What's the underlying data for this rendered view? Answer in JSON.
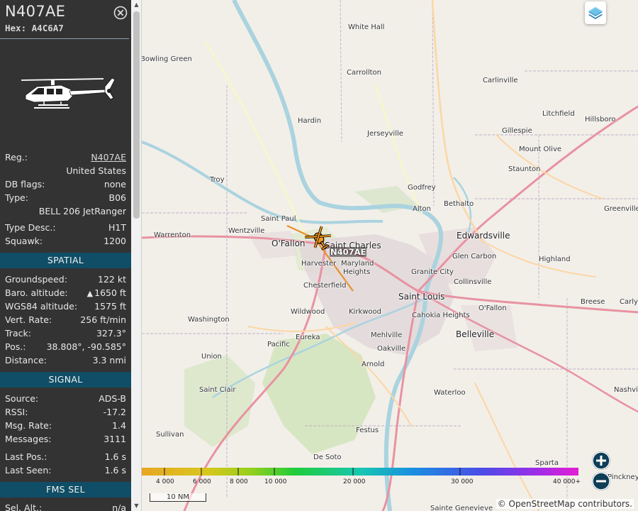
{
  "aircraft": {
    "callsign": "N407AE",
    "hex_label": "Hex:",
    "hex": "A4C6A7"
  },
  "details": [
    {
      "label": "Reg.:",
      "value": "N407AE",
      "link": true
    },
    {
      "sub": "United States"
    },
    {
      "label": "DB flags:",
      "value": "none"
    },
    {
      "label": "Type:",
      "value": "B06"
    },
    {
      "sub": "BELL 206 JetRanger"
    },
    {
      "label": "Type Desc.:",
      "value": "H1T"
    },
    {
      "label": "Squawk:",
      "value": "1200"
    }
  ],
  "sections": {
    "spatial": "SPATIAL",
    "signal": "SIGNAL",
    "fms": "FMS SEL"
  },
  "spatial": {
    "groundspeed_label": "Groundspeed:",
    "groundspeed": "122 kt",
    "baro_label": "Baro. altitude:",
    "baro_arrow": "▲",
    "baro": "1650 ft",
    "wgs84_label": "WGS84 altitude:",
    "wgs84": "1575 ft",
    "vrate_label": "Vert. Rate:",
    "vrate": "256 ft/min",
    "track_label": "Track:",
    "track": "327.3°",
    "pos_label": "Pos.:",
    "pos": "38.808°, -90.585°",
    "distance_label": "Distance:",
    "distance": "3.3 nmi"
  },
  "signal": {
    "source_label": "Source:",
    "source": "ADS-B",
    "rssi_label": "RSSI:",
    "rssi": "-17.2",
    "msgrate_label": "Msg. Rate:",
    "msgrate": "1.4",
    "messages_label": "Messages:",
    "messages": "3111",
    "lastpos_label": "Last Pos.:",
    "lastpos": "1.6 s",
    "lastseen_label": "Last Seen:",
    "lastseen": "1.6 s"
  },
  "fms": {
    "selalt_label": "Sel. Alt.:",
    "selalt": "n/a"
  },
  "map": {
    "aircraft_label": "N407AE",
    "places": [
      {
        "name": "White Hall",
        "big": false
      },
      {
        "name": "Bowling Green",
        "big": false
      },
      {
        "name": "Carrollton",
        "big": false
      },
      {
        "name": "Carlinville",
        "big": false
      },
      {
        "name": "Litchfield",
        "big": false
      },
      {
        "name": "Hillsboro",
        "big": false
      },
      {
        "name": "Hardin",
        "big": false
      },
      {
        "name": "Jerseyville",
        "big": false
      },
      {
        "name": "Gillespie",
        "big": false
      },
      {
        "name": "Mount Olive",
        "big": false
      },
      {
        "name": "Staunton",
        "big": false
      },
      {
        "name": "Troy",
        "big": false
      },
      {
        "name": "Godfrey",
        "big": false
      },
      {
        "name": "Bethalto",
        "big": false
      },
      {
        "name": "Alton",
        "big": false
      },
      {
        "name": "Greenville",
        "big": false
      },
      {
        "name": "Saint Paul",
        "big": false
      },
      {
        "name": "Wentzville",
        "big": false
      },
      {
        "name": "Warrenton",
        "big": false
      },
      {
        "name": "O'Fallon",
        "big": true
      },
      {
        "name": "Saint Charles",
        "big": true
      },
      {
        "name": "Edwardsville",
        "big": true
      },
      {
        "name": "Glen Carbon",
        "big": false
      },
      {
        "name": "Harvester",
        "big": false
      },
      {
        "name": "Maryland",
        "big": false
      },
      {
        "name": "Heights",
        "big": false
      },
      {
        "name": "Granite City",
        "big": false
      },
      {
        "name": "Highland",
        "big": false
      },
      {
        "name": "Chesterfield",
        "big": false
      },
      {
        "name": "Collinsville",
        "big": false
      },
      {
        "name": "Saint Louis",
        "big": true
      },
      {
        "name": "Breese",
        "big": false
      },
      {
        "name": "Carlyle",
        "big": false
      },
      {
        "name": "Wildwood",
        "big": false
      },
      {
        "name": "Kirkwood",
        "big": false
      },
      {
        "name": "Cahokia Heights",
        "big": false
      },
      {
        "name": "O'Fallon",
        "big": false
      },
      {
        "name": "Washington",
        "big": false
      },
      {
        "name": "Eureka",
        "big": false
      },
      {
        "name": "Mehlville",
        "big": false
      },
      {
        "name": "Belleville",
        "big": true
      },
      {
        "name": "Pacific",
        "big": false
      },
      {
        "name": "Oakville",
        "big": false
      },
      {
        "name": "Union",
        "big": false
      },
      {
        "name": "Arnold",
        "big": false
      },
      {
        "name": "Saint Clair",
        "big": false
      },
      {
        "name": "Waterloo",
        "big": false
      },
      {
        "name": "Nashville",
        "big": false
      },
      {
        "name": "Sullivan",
        "big": false
      },
      {
        "name": "Festus",
        "big": false
      },
      {
        "name": "Sparta",
        "big": false
      },
      {
        "name": "De Soto",
        "big": false
      },
      {
        "name": "Pinckneyville",
        "big": false
      },
      {
        "name": "Sainte Genevieve",
        "big": false
      }
    ],
    "altitude_scale": [
      "4 000",
      "6 000",
      "8 000",
      "10 000",
      "20 000",
      "30 000",
      "40 000+"
    ],
    "scale_bar": "10 NM",
    "attribution": "© OpenStreetMap contributors."
  },
  "colors": {
    "sidebar_bg": "#333333",
    "section_bg": "#0f4e66",
    "track": "#e8902a",
    "aircraft": "#f29a1e",
    "zoom_button": "#0f3e57"
  },
  "icons": {
    "close": "close-circle-icon",
    "layers": "layers-icon",
    "zoom_in": "plus-icon",
    "zoom_out": "minus-icon",
    "aircraft": "helicopter-icon"
  }
}
